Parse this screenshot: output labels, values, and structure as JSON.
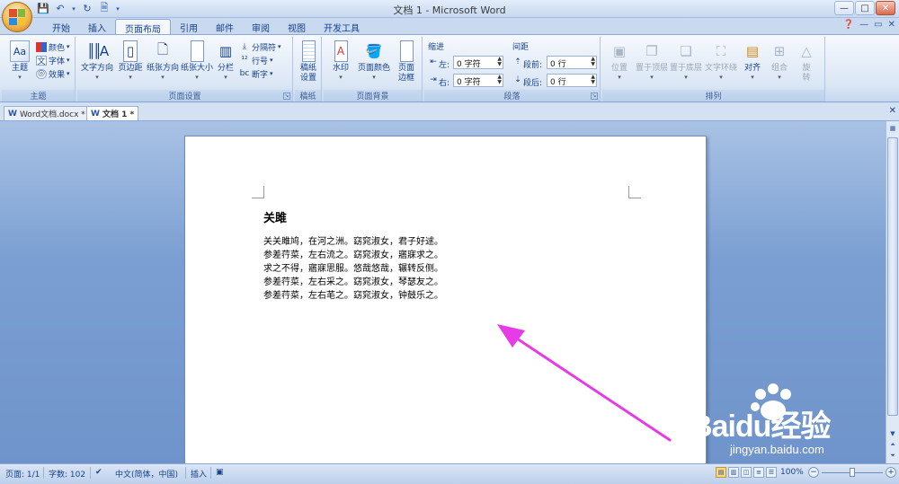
{
  "window": {
    "title": "文档 1 - Microsoft Word",
    "minimize": "—",
    "maximize": "□",
    "close": "✕"
  },
  "tabs": [
    "开始",
    "插入",
    "页面布局",
    "引用",
    "邮件",
    "审阅",
    "视图",
    "开发工具"
  ],
  "active_tab": "页面布局",
  "ribbon": {
    "themes": {
      "label": "主题",
      "theme_btn": "主题",
      "colors": "颜色",
      "fonts": "字体",
      "effects": "效果"
    },
    "page_setup": {
      "label": "页面设置",
      "text_direction": "文字方向",
      "margins": "页边距",
      "orientation": "纸张方向",
      "size": "纸张大小",
      "columns": "分栏",
      "breaks": "分隔符",
      "line_numbers": "行号",
      "hyphenation": "断字"
    },
    "manuscript": {
      "label": "稿纸",
      "setup_line1": "稿纸",
      "setup_line2": "设置"
    },
    "page_background": {
      "label": "页面背景",
      "watermark": "水印",
      "page_color": "页面颜色",
      "borders_line1": "页面",
      "borders_line2": "边框"
    },
    "paragraph": {
      "label": "段落",
      "indent_header": "缩进",
      "spacing_header": "间距",
      "left_label": "左:",
      "left_value": "0 字符",
      "right_label": "右:",
      "right_value": "0 字符",
      "before_label": "段前:",
      "before_value": "0 行",
      "after_label": "段后:",
      "after_value": "0 行"
    },
    "arrange": {
      "label": "排列",
      "position": "位置",
      "bring_front": "置于顶层",
      "send_back": "置于底层",
      "text_wrap": "文字环绕",
      "align": "对齐",
      "group": "组合",
      "rotate_line1": "旋",
      "rotate_line2": "转"
    }
  },
  "doc_tabs": [
    "Word文档.docx *",
    "文档 1 *"
  ],
  "document": {
    "title": "关雎",
    "lines": [
      "关关雎鸠，在河之洲。窈窕淑女，君子好逑。",
      "参差荇菜，左右流之。窈窕淑女，寤寐求之。",
      "求之不得，寤寐思服。悠哉悠哉，辗转反侧。",
      "参差荇菜，左右采之。窈窕淑女，琴瑟友之。",
      "参差荇菜，左右芼之。窈窕淑女，钟鼓乐之。"
    ]
  },
  "status": {
    "page": "页面: 1/1",
    "words": "字数: 102",
    "language": "中文(简体，中国)",
    "mode": "插入",
    "zoom": "100%",
    "zoom_level": 100
  },
  "watermark": {
    "brand": "Baidu经验",
    "url": "jingyan.baidu.com"
  },
  "colors": {
    "annotation_arrow": "#e63be6",
    "ribbon_text": "#15428b",
    "workspace": "#7b9fd2"
  }
}
